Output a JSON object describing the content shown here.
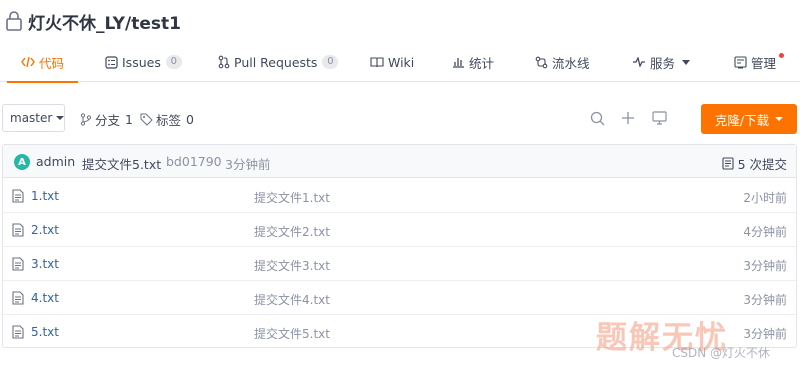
{
  "repo": {
    "owner": "灯火不休_LY",
    "separator": "/",
    "name": "test1"
  },
  "tabs": [
    {
      "label": "代码",
      "icon": "code-icon",
      "active": true
    },
    {
      "label": "Issues",
      "badge": "0",
      "icon": "issues-icon"
    },
    {
      "label": "Pull Requests",
      "badge": "0",
      "icon": "pull-request-icon"
    },
    {
      "label": "Wiki",
      "icon": "wiki-icon"
    },
    {
      "label": "统计",
      "icon": "stats-icon"
    },
    {
      "label": "流水线",
      "icon": "pipeline-icon"
    },
    {
      "label": "服务",
      "icon": "service-icon"
    },
    {
      "label": "管理",
      "icon": "manage-icon"
    }
  ],
  "toolbar": {
    "branch": "master",
    "branches_label": "分支",
    "branches_count": "1",
    "tags_label": "标签",
    "tags_count": "0",
    "clone_label": "克隆/下载"
  },
  "commit": {
    "avatar_letter": "A",
    "author": "admin",
    "message": "提交文件5.txt",
    "hash": "bd01790",
    "time": "3分钟前",
    "count_label": "5 次提交"
  },
  "files": [
    {
      "name": "1.txt",
      "commit": "提交文件1.txt",
      "time": "2小时前"
    },
    {
      "name": "2.txt",
      "commit": "提交文件2.txt",
      "time": "4分钟前"
    },
    {
      "name": "3.txt",
      "commit": "提交文件3.txt",
      "time": "3分钟前"
    },
    {
      "name": "4.txt",
      "commit": "提交文件4.txt",
      "time": "3分钟前"
    },
    {
      "name": "5.txt",
      "commit": "提交文件5.txt",
      "time": "3分钟前"
    }
  ],
  "watermark": {
    "text": "题解无忧",
    "credit": "CSDN @灯火不休"
  },
  "colors": {
    "accent": "#fe7300",
    "link": "#2b62b3",
    "avatar": "#26b7a6"
  }
}
